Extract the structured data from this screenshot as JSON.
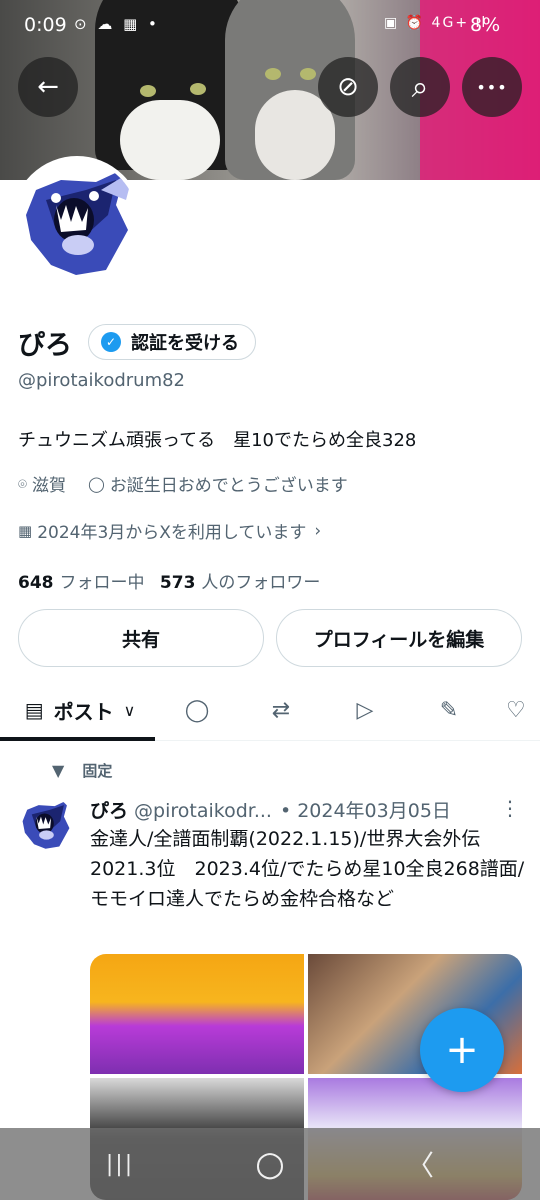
{
  "status_bar": {
    "time": "0:09",
    "left_icons": "⊙ ☁ ▦ •",
    "right_icons": "▣ ⏰ 4G+ ıl",
    "battery": "8%"
  },
  "header_buttons": {
    "back_icon": "←",
    "circle_icon": "⊘",
    "search_icon": "⌕",
    "more_icon": "•••"
  },
  "profile": {
    "name": "ぴろ",
    "verify_label": "認証を受ける",
    "verify_badge": "✓",
    "handle": "@pirotaikodrum82",
    "bio": "チュウニズム頑張ってる　星10でたらめ全良328",
    "location": "滋賀",
    "birthday_note": "お誕生日おめでとうございます",
    "joined": "2024年3月からXを利用しています",
    "following_count": "648",
    "following_label": "フォロー中",
    "followers_count": "573",
    "followers_label": "人のフォロワー",
    "share_label": "共有",
    "edit_label": "プロフィールを編集"
  },
  "tabs": {
    "posts_label": "ポスト",
    "posts_chevron": "∨"
  },
  "post": {
    "pinned_label": "固定",
    "author": "ぴろ",
    "handle": "@pirotaikodr...",
    "date": "• 2024年03月05日",
    "more": "⋮",
    "text": "金達人/全譜面制覇(2022.1.15)/世界大会外伝2021.3位　2023.4位/でたらめ星10全良268譜面/モモイロ達人でたらめ金枠合格など"
  },
  "fab_label": "+",
  "nav": {
    "recents": "|||",
    "home": "○",
    "back": "〈"
  },
  "colors": {
    "accent": "#1d9bf0",
    "text_primary": "#0f1419",
    "text_secondary": "#536471",
    "border": "#cfd9de"
  }
}
